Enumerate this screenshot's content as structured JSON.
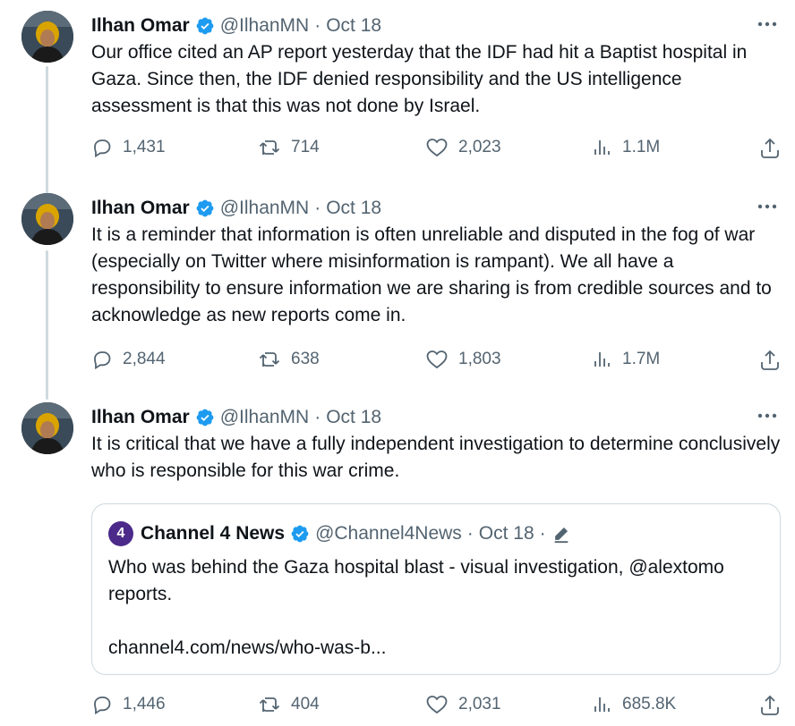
{
  "colors": {
    "verified": "#1d9bf0",
    "muted": "#536471",
    "text": "#0f1419",
    "border": "#cfd9de",
    "channel4": "#4b2a8a"
  },
  "icons": {
    "reply": "reply-icon",
    "retweet": "retweet-icon",
    "like": "heart-icon",
    "views": "views-icon",
    "share": "share-icon",
    "more": "more-icon"
  },
  "tweets": [
    {
      "name": "Ilhan Omar",
      "handle": "@IlhanMN",
      "dot": "·",
      "date": "Oct 18",
      "text": "Our office cited an AP report yesterday that the IDF had hit a Baptist hospital in Gaza. Since then, the IDF denied responsibility and the US intelligence assessment is that this was not done by Israel.",
      "replies": "1,431",
      "retweets": "714",
      "likes": "2,023",
      "views": "1.1M"
    },
    {
      "name": "Ilhan Omar",
      "handle": "@IlhanMN",
      "dot": "·",
      "date": "Oct 18",
      "text": "It is a reminder that information is often unreliable and disputed in the fog of war (especially on Twitter where misinformation is rampant). We all have a responsibility to ensure information we are sharing is from credible sources and to acknowledge as new reports come in.",
      "replies": "2,844",
      "retweets": "638",
      "likes": "1,803",
      "views": "1.7M"
    },
    {
      "name": "Ilhan Omar",
      "handle": "@IlhanMN",
      "dot": "·",
      "date": "Oct 18",
      "text": "It is critical that we have a fully independent investigation to determine conclusively who is responsible for this war crime.",
      "replies": "1,446",
      "retweets": "404",
      "likes": "2,031",
      "views": "685.8K",
      "quote": {
        "logo": "4",
        "name": "Channel 4 News",
        "handle": "@Channel4News",
        "dot": "·",
        "date": "Oct 18",
        "trail_dot": "·",
        "text": "Who was behind the Gaza hospital blast - visual investigation, @alextomo reports.",
        "link": "channel4.com/news/who-was-b..."
      }
    }
  ]
}
